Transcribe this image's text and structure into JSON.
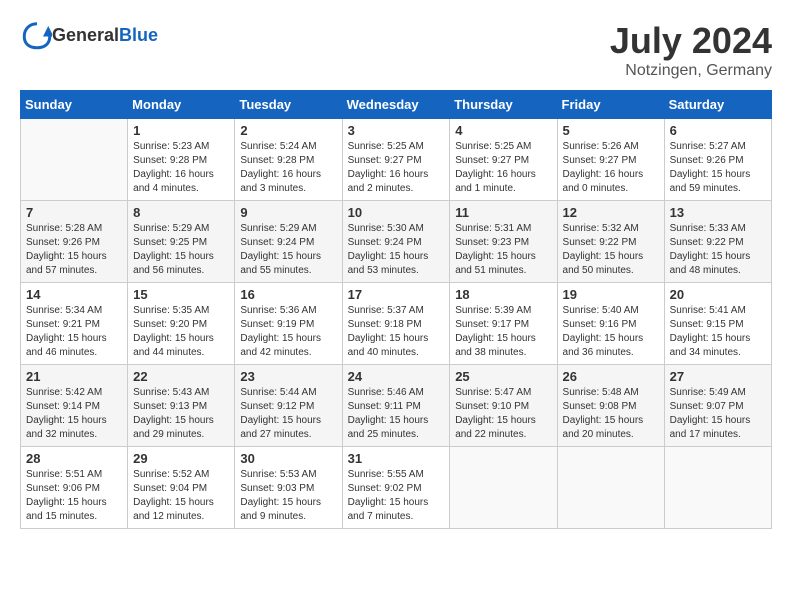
{
  "header": {
    "logo_general": "General",
    "logo_blue": "Blue",
    "month": "July 2024",
    "location": "Notzingen, Germany"
  },
  "weekdays": [
    "Sunday",
    "Monday",
    "Tuesday",
    "Wednesday",
    "Thursday",
    "Friday",
    "Saturday"
  ],
  "weeks": [
    [
      {
        "day": "",
        "sunrise": "",
        "sunset": "",
        "daylight": ""
      },
      {
        "day": "1",
        "sunrise": "Sunrise: 5:23 AM",
        "sunset": "Sunset: 9:28 PM",
        "daylight": "Daylight: 16 hours and 4 minutes."
      },
      {
        "day": "2",
        "sunrise": "Sunrise: 5:24 AM",
        "sunset": "Sunset: 9:28 PM",
        "daylight": "Daylight: 16 hours and 3 minutes."
      },
      {
        "day": "3",
        "sunrise": "Sunrise: 5:25 AM",
        "sunset": "Sunset: 9:27 PM",
        "daylight": "Daylight: 16 hours and 2 minutes."
      },
      {
        "day": "4",
        "sunrise": "Sunrise: 5:25 AM",
        "sunset": "Sunset: 9:27 PM",
        "daylight": "Daylight: 16 hours and 1 minute."
      },
      {
        "day": "5",
        "sunrise": "Sunrise: 5:26 AM",
        "sunset": "Sunset: 9:27 PM",
        "daylight": "Daylight: 16 hours and 0 minutes."
      },
      {
        "day": "6",
        "sunrise": "Sunrise: 5:27 AM",
        "sunset": "Sunset: 9:26 PM",
        "daylight": "Daylight: 15 hours and 59 minutes."
      }
    ],
    [
      {
        "day": "7",
        "sunrise": "Sunrise: 5:28 AM",
        "sunset": "Sunset: 9:26 PM",
        "daylight": "Daylight: 15 hours and 57 minutes."
      },
      {
        "day": "8",
        "sunrise": "Sunrise: 5:29 AM",
        "sunset": "Sunset: 9:25 PM",
        "daylight": "Daylight: 15 hours and 56 minutes."
      },
      {
        "day": "9",
        "sunrise": "Sunrise: 5:29 AM",
        "sunset": "Sunset: 9:24 PM",
        "daylight": "Daylight: 15 hours and 55 minutes."
      },
      {
        "day": "10",
        "sunrise": "Sunrise: 5:30 AM",
        "sunset": "Sunset: 9:24 PM",
        "daylight": "Daylight: 15 hours and 53 minutes."
      },
      {
        "day": "11",
        "sunrise": "Sunrise: 5:31 AM",
        "sunset": "Sunset: 9:23 PM",
        "daylight": "Daylight: 15 hours and 51 minutes."
      },
      {
        "day": "12",
        "sunrise": "Sunrise: 5:32 AM",
        "sunset": "Sunset: 9:22 PM",
        "daylight": "Daylight: 15 hours and 50 minutes."
      },
      {
        "day": "13",
        "sunrise": "Sunrise: 5:33 AM",
        "sunset": "Sunset: 9:22 PM",
        "daylight": "Daylight: 15 hours and 48 minutes."
      }
    ],
    [
      {
        "day": "14",
        "sunrise": "Sunrise: 5:34 AM",
        "sunset": "Sunset: 9:21 PM",
        "daylight": "Daylight: 15 hours and 46 minutes."
      },
      {
        "day": "15",
        "sunrise": "Sunrise: 5:35 AM",
        "sunset": "Sunset: 9:20 PM",
        "daylight": "Daylight: 15 hours and 44 minutes."
      },
      {
        "day": "16",
        "sunrise": "Sunrise: 5:36 AM",
        "sunset": "Sunset: 9:19 PM",
        "daylight": "Daylight: 15 hours and 42 minutes."
      },
      {
        "day": "17",
        "sunrise": "Sunrise: 5:37 AM",
        "sunset": "Sunset: 9:18 PM",
        "daylight": "Daylight: 15 hours and 40 minutes."
      },
      {
        "day": "18",
        "sunrise": "Sunrise: 5:39 AM",
        "sunset": "Sunset: 9:17 PM",
        "daylight": "Daylight: 15 hours and 38 minutes."
      },
      {
        "day": "19",
        "sunrise": "Sunrise: 5:40 AM",
        "sunset": "Sunset: 9:16 PM",
        "daylight": "Daylight: 15 hours and 36 minutes."
      },
      {
        "day": "20",
        "sunrise": "Sunrise: 5:41 AM",
        "sunset": "Sunset: 9:15 PM",
        "daylight": "Daylight: 15 hours and 34 minutes."
      }
    ],
    [
      {
        "day": "21",
        "sunrise": "Sunrise: 5:42 AM",
        "sunset": "Sunset: 9:14 PM",
        "daylight": "Daylight: 15 hours and 32 minutes."
      },
      {
        "day": "22",
        "sunrise": "Sunrise: 5:43 AM",
        "sunset": "Sunset: 9:13 PM",
        "daylight": "Daylight: 15 hours and 29 minutes."
      },
      {
        "day": "23",
        "sunrise": "Sunrise: 5:44 AM",
        "sunset": "Sunset: 9:12 PM",
        "daylight": "Daylight: 15 hours and 27 minutes."
      },
      {
        "day": "24",
        "sunrise": "Sunrise: 5:46 AM",
        "sunset": "Sunset: 9:11 PM",
        "daylight": "Daylight: 15 hours and 25 minutes."
      },
      {
        "day": "25",
        "sunrise": "Sunrise: 5:47 AM",
        "sunset": "Sunset: 9:10 PM",
        "daylight": "Daylight: 15 hours and 22 minutes."
      },
      {
        "day": "26",
        "sunrise": "Sunrise: 5:48 AM",
        "sunset": "Sunset: 9:08 PM",
        "daylight": "Daylight: 15 hours and 20 minutes."
      },
      {
        "day": "27",
        "sunrise": "Sunrise: 5:49 AM",
        "sunset": "Sunset: 9:07 PM",
        "daylight": "Daylight: 15 hours and 17 minutes."
      }
    ],
    [
      {
        "day": "28",
        "sunrise": "Sunrise: 5:51 AM",
        "sunset": "Sunset: 9:06 PM",
        "daylight": "Daylight: 15 hours and 15 minutes."
      },
      {
        "day": "29",
        "sunrise": "Sunrise: 5:52 AM",
        "sunset": "Sunset: 9:04 PM",
        "daylight": "Daylight: 15 hours and 12 minutes."
      },
      {
        "day": "30",
        "sunrise": "Sunrise: 5:53 AM",
        "sunset": "Sunset: 9:03 PM",
        "daylight": "Daylight: 15 hours and 9 minutes."
      },
      {
        "day": "31",
        "sunrise": "Sunrise: 5:55 AM",
        "sunset": "Sunset: 9:02 PM",
        "daylight": "Daylight: 15 hours and 7 minutes."
      },
      {
        "day": "",
        "sunrise": "",
        "sunset": "",
        "daylight": ""
      },
      {
        "day": "",
        "sunrise": "",
        "sunset": "",
        "daylight": ""
      },
      {
        "day": "",
        "sunrise": "",
        "sunset": "",
        "daylight": ""
      }
    ]
  ]
}
